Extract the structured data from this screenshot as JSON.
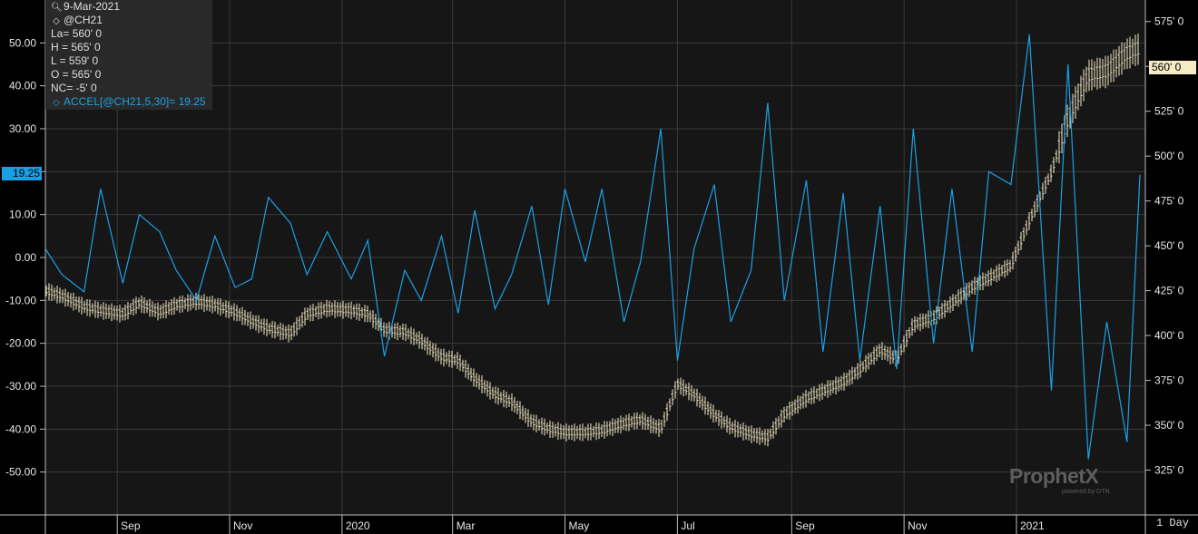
{
  "legend": {
    "date": "9-Mar-2021",
    "symbol": "@CH21",
    "last": "La= 560' 0",
    "high": "H = 565' 0",
    "low": "L = 559' 0",
    "open": "O = 565' 0",
    "net_change": "NC= -5' 0",
    "study": "ACCEL[@CH21,5,30]= 19.25"
  },
  "tags": {
    "accel_value": "19.25",
    "last_price": "560' 0",
    "interval": "1 Day"
  },
  "watermark": {
    "brand": "ProphetX",
    "sub": "powered by DTN"
  },
  "colors": {
    "background": "#161616",
    "axis_bg": "#000000",
    "grid": "#3a3a3a",
    "price_bars": "#f5ecc6",
    "accel_line": "#1aa0e6",
    "axis_text": "#e8e8e8"
  },
  "chart_data": {
    "type": "line",
    "x_tick_labels": [
      "Sep",
      "Nov",
      "2020",
      "Mar",
      "May",
      "Jul",
      "Sep",
      "Nov",
      "2021"
    ],
    "left_axis": {
      "ticks": [
        "50.00",
        "40.00",
        "30.00",
        "20.00",
        "10.00",
        "0.00",
        "-10.00",
        "-20.00",
        "-30.00",
        "-40.00",
        "-50.00"
      ],
      "ylim": [
        -60,
        60
      ]
    },
    "right_axis": {
      "ticks": [
        "575' 0",
        "550' 0",
        "525' 0",
        "500' 0",
        "475' 0",
        "450' 0",
        "425' 0",
        "400' 0",
        "375' 0",
        "350' 0",
        "325' 0"
      ],
      "ylim": [
        300,
        587
      ]
    },
    "series": [
      {
        "name": "@CH21",
        "style": "ohlc-bars",
        "axis": "right",
        "x": [
          "2019-07-24",
          "2019-08-02",
          "2019-08-14",
          "2019-08-23",
          "2019-09-04",
          "2019-09-13",
          "2019-09-24",
          "2019-10-03",
          "2019-10-14",
          "2019-10-24",
          "2019-11-04",
          "2019-11-13",
          "2019-11-22",
          "2019-12-04",
          "2019-12-13",
          "2019-12-24",
          "2020-01-06",
          "2020-01-15",
          "2020-01-24",
          "2020-02-04",
          "2020-02-13",
          "2020-02-24",
          "2020-03-04",
          "2020-03-13",
          "2020-03-24",
          "2020-04-02",
          "2020-04-13",
          "2020-04-22",
          "2020-05-01",
          "2020-05-12",
          "2020-05-21",
          "2020-06-02",
          "2020-06-11",
          "2020-06-22",
          "2020-07-01",
          "2020-07-10",
          "2020-07-21",
          "2020-07-30",
          "2020-08-10",
          "2020-08-19",
          "2020-08-28",
          "2020-09-09",
          "2020-09-18",
          "2020-09-29",
          "2020-10-08",
          "2020-10-19",
          "2020-10-28",
          "2020-11-06",
          "2020-11-17",
          "2020-11-27",
          "2020-12-08",
          "2020-12-17",
          "2020-12-29",
          "2021-01-08",
          "2021-01-20",
          "2021-01-29",
          "2021-02-09",
          "2021-02-19",
          "2021-03-02",
          "2021-03-09"
        ],
        "values": [
          425,
          422,
          416,
          414,
          412,
          418,
          413,
          417,
          419,
          417,
          413,
          408,
          404,
          401,
          412,
          415,
          414,
          412,
          403,
          402,
          397,
          388,
          386,
          376,
          367,
          363,
          352,
          348,
          346,
          346,
          347,
          351,
          353,
          348,
          373,
          367,
          356,
          349,
          345,
          343,
          356,
          365,
          369,
          374,
          381,
          392,
          387,
          406,
          410,
          418,
          427,
          432,
          439,
          464,
          491,
          521,
          545,
          547,
          557,
          560
        ]
      },
      {
        "name": "ACCEL[@CH21,5,30]",
        "style": "line",
        "axis": "left",
        "x": [
          "2019-07-24",
          "2019-08-02",
          "2019-08-14",
          "2019-08-23",
          "2019-09-04",
          "2019-09-13",
          "2019-09-24",
          "2019-10-03",
          "2019-10-14",
          "2019-10-24",
          "2019-11-04",
          "2019-11-13",
          "2019-11-22",
          "2019-12-04",
          "2019-12-13",
          "2019-12-24",
          "2020-01-06",
          "2020-01-15",
          "2020-01-24",
          "2020-02-04",
          "2020-02-13",
          "2020-02-24",
          "2020-03-04",
          "2020-03-13",
          "2020-03-24",
          "2020-04-02",
          "2020-04-13",
          "2020-04-22",
          "2020-05-01",
          "2020-05-12",
          "2020-05-21",
          "2020-06-02",
          "2020-06-11",
          "2020-06-22",
          "2020-07-01",
          "2020-07-10",
          "2020-07-21",
          "2020-07-30",
          "2020-08-10",
          "2020-08-19",
          "2020-08-28",
          "2020-09-09",
          "2020-09-18",
          "2020-09-29",
          "2020-10-08",
          "2020-10-19",
          "2020-10-28",
          "2020-11-06",
          "2020-11-17",
          "2020-11-27",
          "2020-12-08",
          "2020-12-17",
          "2020-12-29",
          "2021-01-08",
          "2021-01-20",
          "2021-01-29",
          "2021-02-09",
          "2021-02-19",
          "2021-03-02",
          "2021-03-09"
        ],
        "values": [
          2,
          -4,
          -8,
          16,
          -6,
          10,
          6,
          -3,
          -10,
          5,
          -7,
          -5,
          14,
          8,
          -4,
          6,
          -5,
          4,
          -23,
          -3,
          -10,
          5,
          -13,
          11,
          -12,
          -4,
          12,
          -11,
          16,
          -1,
          16,
          -15,
          -1,
          30,
          -24,
          2,
          17,
          -15,
          -3,
          36,
          -10,
          18,
          -22,
          15,
          -24,
          12,
          -26,
          30,
          -20,
          16,
          -22,
          20,
          17,
          52,
          -31,
          45,
          -47,
          -15,
          -43,
          19.25
        ]
      }
    ]
  }
}
